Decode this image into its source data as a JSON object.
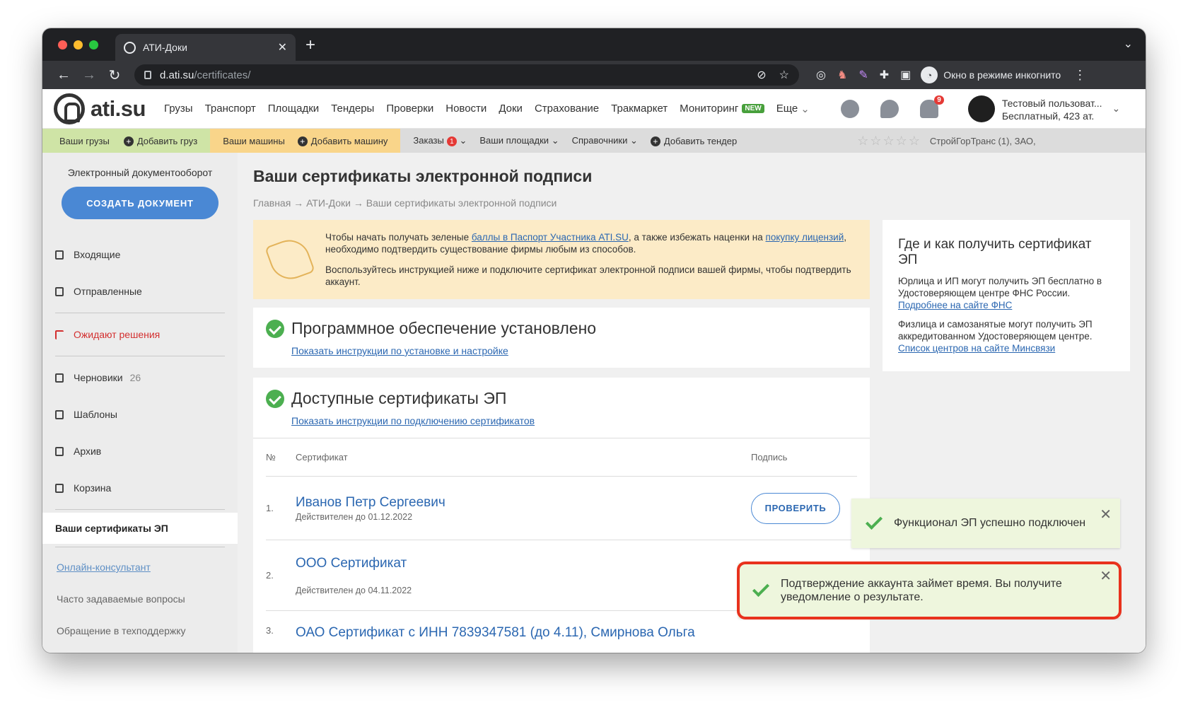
{
  "browser": {
    "tab_title": "АТИ-Доки",
    "url_host": "d.ati.su",
    "url_path": "/certificates/",
    "incognito_label": "Окно в режиме инкогнито",
    "colors": {
      "close": "#ff5f57",
      "minimize": "#febc2e",
      "maximize": "#28c840"
    }
  },
  "header": {
    "logo_text": "ati.su",
    "nav": [
      "Грузы",
      "Транспорт",
      "Площадки",
      "Тендеры",
      "Проверки",
      "Новости",
      "Доки",
      "Страхование",
      "Тракмаркет",
      "Мониторинг",
      "Еще"
    ],
    "new_badge": "NEW",
    "notifications_count": "9",
    "user_name": "Тестовый пользоват...",
    "user_plan": "Бесплатный,",
    "user_balance": "423 ат."
  },
  "subnav": {
    "your_cargo": "Ваши грузы",
    "add_cargo": "Добавить груз",
    "your_trucks": "Ваши машины",
    "add_truck": "Добавить машину",
    "orders": "Заказы",
    "orders_count": "1",
    "your_sites": "Ваши площадки",
    "references": "Справочники",
    "add_tender": "Добавить тендер",
    "firm": "СтройГорТранс (1), ЗАО,"
  },
  "sidebar": {
    "title": "Электронный документооборот",
    "create_button": "Создать документ",
    "incoming": "Входящие",
    "sent": "Отправленные",
    "awaiting": "Ожидают решения",
    "drafts": "Черновики",
    "drafts_count": "26",
    "templates": "Шаблоны",
    "archive": "Архив",
    "trash": "Корзина",
    "certificates": "Ваши сертификаты ЭП",
    "consultant": "Онлайн-консультант",
    "faq": "Часто задаваемые вопросы",
    "support": "Обращение в техподдержку"
  },
  "page": {
    "title": "Ваши сертификаты электронной подписи",
    "breadcrumb": "Главная → АТИ-Доки → Ваши сертификаты электронной подписи"
  },
  "notice": {
    "p1_start": "Чтобы начать получать зеленые ",
    "p1_link1": "баллы в Паспорт Участника ATI.SU",
    "p1_mid": ", а также избежать наценки на ",
    "p1_link2": "покупку лицензий",
    "p1_end": ", необходимо подтвердить существование фирмы любым из способов.",
    "p2": "Воспользуйтесь инструкцией ниже и подключите сертификат электронной подписи вашей фирмы, чтобы подтвердить аккаунт."
  },
  "software_card": {
    "title": "Программное обеспечение установлено",
    "link": "Показать инструкции по установке и настройке"
  },
  "certs_card": {
    "title": "Доступные сертификаты ЭП",
    "link": "Показать инструкции по подключению сертификатов",
    "col_num": "№",
    "col_cert": "Сертификат",
    "col_sign": "Подпись",
    "rows": [
      {
        "num": "1.",
        "name": "Иванов Петр Сергеевич",
        "valid": "Действителен до 01.12.2022",
        "action": "Проверить"
      },
      {
        "num": "2.",
        "name": "ООО Сертификат",
        "valid": "Действителен до 04.11.2022"
      },
      {
        "num": "3.",
        "name": "ОАО Сертификат с ИНН 7839347581 (до 4.11), Смирнова Ольга"
      }
    ]
  },
  "side_info": {
    "title": "Где и как получить сертификат ЭП",
    "p1": "Юрлица и ИП могут получить ЭП бесплатно в Удостоверяющем центре ФНС России.",
    "p1_link": "Подробнее на сайте ФНС",
    "p2": "Физлица и самозанятые могут получить ЭП аккредитованном Удостоверяющем центре.",
    "p2_link": "Список центров на сайте Минсвязи"
  },
  "toasts": {
    "first": "Функционал ЭП успешно подключен",
    "second": "Подтверждение аккаунта займет время. Вы получите уведомление о результате."
  }
}
